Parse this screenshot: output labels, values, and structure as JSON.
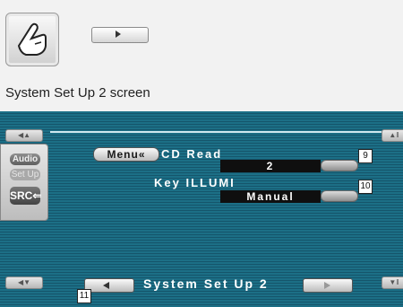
{
  "caption": "System Set Up 2 screen",
  "sidebar": {
    "audio_label": "Audio",
    "setup_label": "Set Up",
    "src_label": "SRC"
  },
  "menu_label": "Menu«",
  "settings": [
    {
      "label": "CD Read",
      "value": "2",
      "badge": "9"
    },
    {
      "label": "Key ILLUMI",
      "value": "Manual",
      "badge": "10"
    }
  ],
  "screen_title": "System Set Up 2",
  "nav_badge": "11",
  "icons": [
    "hand-touch-icon",
    "play-icon",
    "arrow-left-icon",
    "arrow-right-icon"
  ],
  "colors": {
    "screen_bg": "#1c6f86",
    "value_bg": "#0f0f0f",
    "text": "#ffffff"
  }
}
